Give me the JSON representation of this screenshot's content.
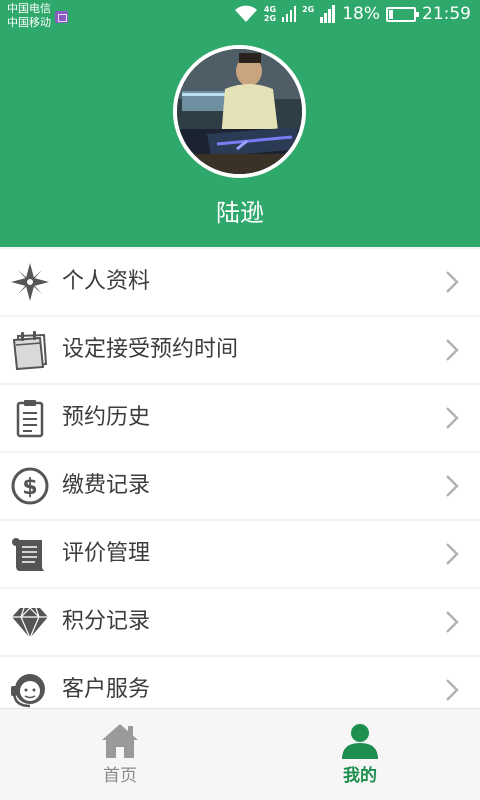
{
  "status_bar": {
    "carrier_1": "中国电信",
    "carrier_2": "中国移动",
    "net_top": "4G",
    "net_bottom": "2G",
    "net_2": "2G",
    "battery_percent": "18%",
    "battery_level": 0.18,
    "time": "21:59"
  },
  "profile": {
    "name": "陆逊"
  },
  "menu": {
    "items": [
      {
        "label": "个人资料",
        "icon": "compass-icon"
      },
      {
        "label": "设定接受预约时间",
        "icon": "calendar-icon"
      },
      {
        "label": "预约历史",
        "icon": "clipboard-icon"
      },
      {
        "label": "缴费记录",
        "icon": "dollar-icon"
      },
      {
        "label": "评价管理",
        "icon": "scroll-icon"
      },
      {
        "label": "积分记录",
        "icon": "diamond-icon"
      },
      {
        "label": "客户服务",
        "icon": "headset-icon"
      }
    ]
  },
  "tabbar": {
    "home_label": "首页",
    "mine_label": "我的",
    "active_color": "#1f8f4f",
    "inactive_color": "#8a8a8a"
  },
  "colors": {
    "header_green": "#2ea86b",
    "icon_gray": "#555555"
  }
}
